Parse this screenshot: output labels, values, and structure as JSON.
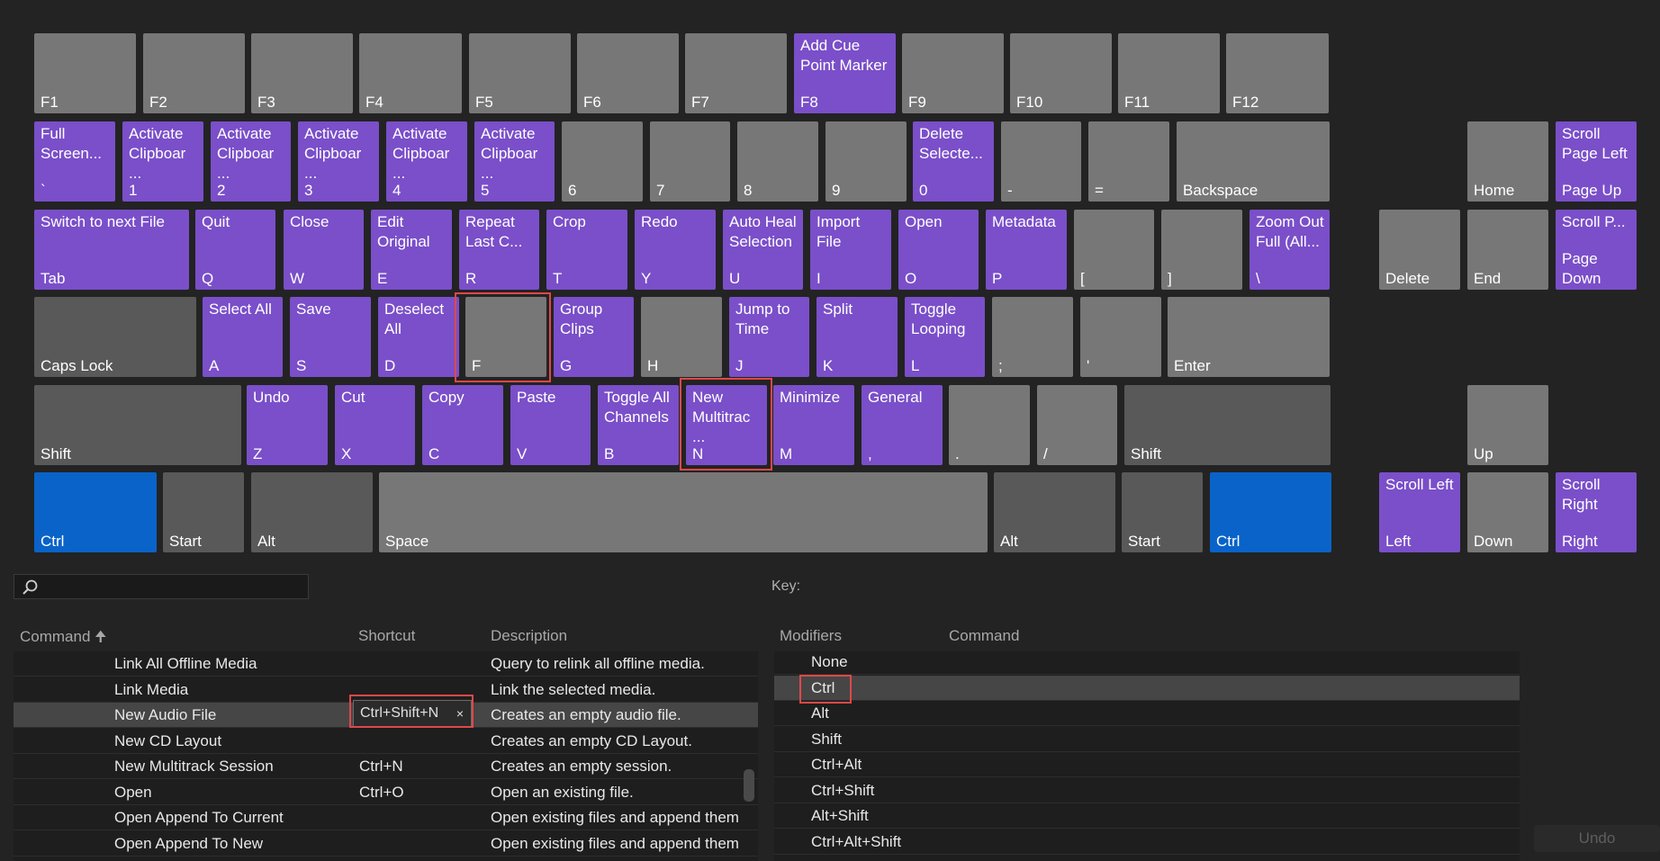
{
  "keyboard": {
    "row1": [
      {
        "key": "F1",
        "cmd": ""
      },
      {
        "key": "F2",
        "cmd": ""
      },
      {
        "key": "F3",
        "cmd": ""
      },
      {
        "key": "F4",
        "cmd": ""
      },
      {
        "key": "F5",
        "cmd": ""
      },
      {
        "key": "F6",
        "cmd": ""
      },
      {
        "key": "F7",
        "cmd": ""
      },
      {
        "key": "F8",
        "cmd": "Add Cue\nPoint Marker"
      },
      {
        "key": "F9",
        "cmd": ""
      },
      {
        "key": "F10",
        "cmd": ""
      },
      {
        "key": "F11",
        "cmd": ""
      },
      {
        "key": "F12",
        "cmd": ""
      }
    ],
    "row2": [
      {
        "key": "`",
        "cmd": "Full\nScreen..."
      },
      {
        "key": "1",
        "cmd": "Activate\nClipboar\n..."
      },
      {
        "key": "2",
        "cmd": "Activate\nClipboar\n..."
      },
      {
        "key": "3",
        "cmd": "Activate\nClipboar\n..."
      },
      {
        "key": "4",
        "cmd": "Activate\nClipboar\n..."
      },
      {
        "key": "5",
        "cmd": "Activate\nClipboar\n..."
      },
      {
        "key": "6",
        "cmd": ""
      },
      {
        "key": "7",
        "cmd": ""
      },
      {
        "key": "8",
        "cmd": ""
      },
      {
        "key": "9",
        "cmd": ""
      },
      {
        "key": "0",
        "cmd": "Delete\nSelecte..."
      },
      {
        "key": "-",
        "cmd": ""
      },
      {
        "key": "=",
        "cmd": ""
      },
      {
        "key": "Backspace",
        "cmd": ""
      },
      {
        "key": "Home",
        "cmd": ""
      },
      {
        "key": "Page Up",
        "cmd": "Scroll\nPage Left"
      }
    ],
    "row3": [
      {
        "key": "Tab",
        "cmd": "Switch to next File"
      },
      {
        "key": "Q",
        "cmd": "Quit"
      },
      {
        "key": "W",
        "cmd": "Close"
      },
      {
        "key": "E",
        "cmd": "Edit\nOriginal"
      },
      {
        "key": "R",
        "cmd": "Repeat\nLast C..."
      },
      {
        "key": "T",
        "cmd": "Crop"
      },
      {
        "key": "Y",
        "cmd": "Redo"
      },
      {
        "key": "U",
        "cmd": "Auto Heal\nSelection"
      },
      {
        "key": "I",
        "cmd": "Import\nFile"
      },
      {
        "key": "O",
        "cmd": "Open"
      },
      {
        "key": "P",
        "cmd": "Metadata"
      },
      {
        "key": "[",
        "cmd": ""
      },
      {
        "key": "]",
        "cmd": ""
      },
      {
        "key": "\\",
        "cmd": "Zoom Out\nFull (All..."
      },
      {
        "key": "Delete",
        "cmd": ""
      },
      {
        "key": "End",
        "cmd": ""
      },
      {
        "key": "Page\nDown",
        "cmd": "Scroll P..."
      }
    ],
    "row4": [
      {
        "key": "Caps Lock",
        "cmd": ""
      },
      {
        "key": "A",
        "cmd": "Select All"
      },
      {
        "key": "S",
        "cmd": "Save"
      },
      {
        "key": "D",
        "cmd": "Deselect\nAll"
      },
      {
        "key": "F",
        "cmd": ""
      },
      {
        "key": "G",
        "cmd": "Group\nClips"
      },
      {
        "key": "H",
        "cmd": ""
      },
      {
        "key": "J",
        "cmd": "Jump to\nTime"
      },
      {
        "key": "K",
        "cmd": "Split"
      },
      {
        "key": "L",
        "cmd": "Toggle\nLooping"
      },
      {
        "key": ";",
        "cmd": ""
      },
      {
        "key": "'",
        "cmd": ""
      },
      {
        "key": "Enter",
        "cmd": ""
      }
    ],
    "row5": [
      {
        "key": "Shift",
        "cmd": ""
      },
      {
        "key": "Z",
        "cmd": "Undo"
      },
      {
        "key": "X",
        "cmd": "Cut"
      },
      {
        "key": "C",
        "cmd": "Copy"
      },
      {
        "key": "V",
        "cmd": "Paste"
      },
      {
        "key": "B",
        "cmd": "Toggle All\nChannels"
      },
      {
        "key": "N",
        "cmd": "New\nMultitrac\n..."
      },
      {
        "key": "M",
        "cmd": "Minimize"
      },
      {
        "key": ",",
        "cmd": "General"
      },
      {
        "key": ".",
        "cmd": ""
      },
      {
        "key": "/",
        "cmd": ""
      },
      {
        "key": "Shift",
        "cmd": ""
      },
      {
        "key": "Up",
        "cmd": ""
      }
    ],
    "row6": [
      {
        "key": "Ctrl",
        "cmd": ""
      },
      {
        "key": "Start",
        "cmd": ""
      },
      {
        "key": "Alt",
        "cmd": ""
      },
      {
        "key": "Space",
        "cmd": ""
      },
      {
        "key": "Alt",
        "cmd": ""
      },
      {
        "key": "Start",
        "cmd": ""
      },
      {
        "key": "Ctrl",
        "cmd": ""
      },
      {
        "key": "Left",
        "cmd": "Scroll Left"
      },
      {
        "key": "Down",
        "cmd": ""
      },
      {
        "key": "Right",
        "cmd": "Scroll\nRight"
      }
    ]
  },
  "key_label": "Key:",
  "command_table": {
    "headers": {
      "command": "Command",
      "shortcut": "Shortcut",
      "description": "Description"
    },
    "sort_icon": "arrow-up-icon",
    "rows": [
      {
        "command": "Link All Offline Media",
        "shortcut": "",
        "description": "Query to relink all offline media."
      },
      {
        "command": "Link Media",
        "shortcut": "",
        "description": "Link the selected media."
      },
      {
        "command": "New Audio File",
        "shortcut": "Ctrl+Shift+N",
        "description": "Creates an empty audio file."
      },
      {
        "command": "New CD Layout",
        "shortcut": "",
        "description": "Creates an empty CD Layout."
      },
      {
        "command": "New Multitrack Session",
        "shortcut": "Ctrl+N",
        "description": "Creates an empty session."
      },
      {
        "command": "Open",
        "shortcut": "Ctrl+O",
        "description": "Open an existing file."
      },
      {
        "command": "Open Append To Current",
        "shortcut": "",
        "description": "Open existing files and append them"
      },
      {
        "command": "Open Append To New",
        "shortcut": "",
        "description": "Open existing files and append them"
      }
    ],
    "remove_glyph": "×"
  },
  "modifier_table": {
    "headers": {
      "modifiers": "Modifiers",
      "command": "Command"
    },
    "rows": [
      "None",
      "Ctrl",
      "Alt",
      "Shift",
      "Ctrl+Alt",
      "Ctrl+Shift",
      "Alt+Shift",
      "Ctrl+Alt+Shift"
    ]
  },
  "undo_label": "Undo",
  "colors": {
    "command_key": "#7a4fc9",
    "modifier_active": "#0a63c9",
    "highlight": "#e04848"
  }
}
